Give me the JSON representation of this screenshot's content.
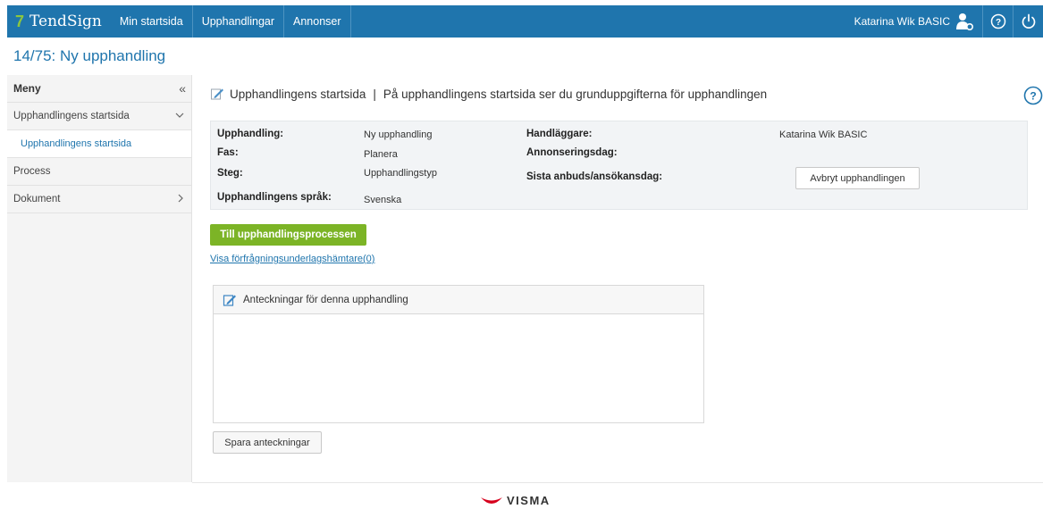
{
  "topbar": {
    "logo_mark": "7",
    "logo_text": "TendSign",
    "nav": [
      "Min startsida",
      "Upphandlingar",
      "Annonser"
    ],
    "user": "Katarina Wik BASIC",
    "icons": [
      "user-icon",
      "help-icon",
      "power-icon"
    ]
  },
  "page_title": "14/75: Ny upphandling",
  "sidebar": {
    "title": "Meny",
    "collapse": "«",
    "items": [
      {
        "label": "Upphandlingens startsida",
        "chevron": "⌄"
      },
      {
        "label": "Upphandlingens startsida"
      },
      {
        "label": "Process"
      },
      {
        "label": "Dokument",
        "chevron": "›"
      }
    ]
  },
  "main": {
    "heading_title": "Upphandlingens startsida",
    "heading_sep": "|",
    "heading_desc": "På upphandlingens startsida ser du grunduppgifterna för upphandlingen",
    "info": {
      "upphandling_label": "Upphandling:",
      "upphandling_value": "Ny upphandling",
      "fas_label": "Fas:",
      "fas_value": "Planera",
      "steg_label": "Steg:",
      "steg_value": "Upphandlingstyp",
      "sprak_label": "Upphandlingens språk:",
      "sprak_value": "Svenska",
      "handlaggare_label": "Handläggare:",
      "handlaggare_value": "Katarina Wik BASIC",
      "annons_label": "Annonseringsdag:",
      "sista_label": "Sista anbuds/ansökansdag:",
      "cancel_button": "Avbryt upphandlingen"
    },
    "process_button": "Till upphandlingsprocessen",
    "link": "Visa förfrågningsunderlagshämtare(0)",
    "notes_title": "Anteckningar för denna upphandling",
    "save_button": "Spara anteckningar"
  },
  "footer": {
    "brand": "VISMA"
  },
  "colors": {
    "primary": "#1f75ad",
    "green": "#7cb426",
    "logo_green": "#8cc63f",
    "visma_red": "#d6001c"
  }
}
